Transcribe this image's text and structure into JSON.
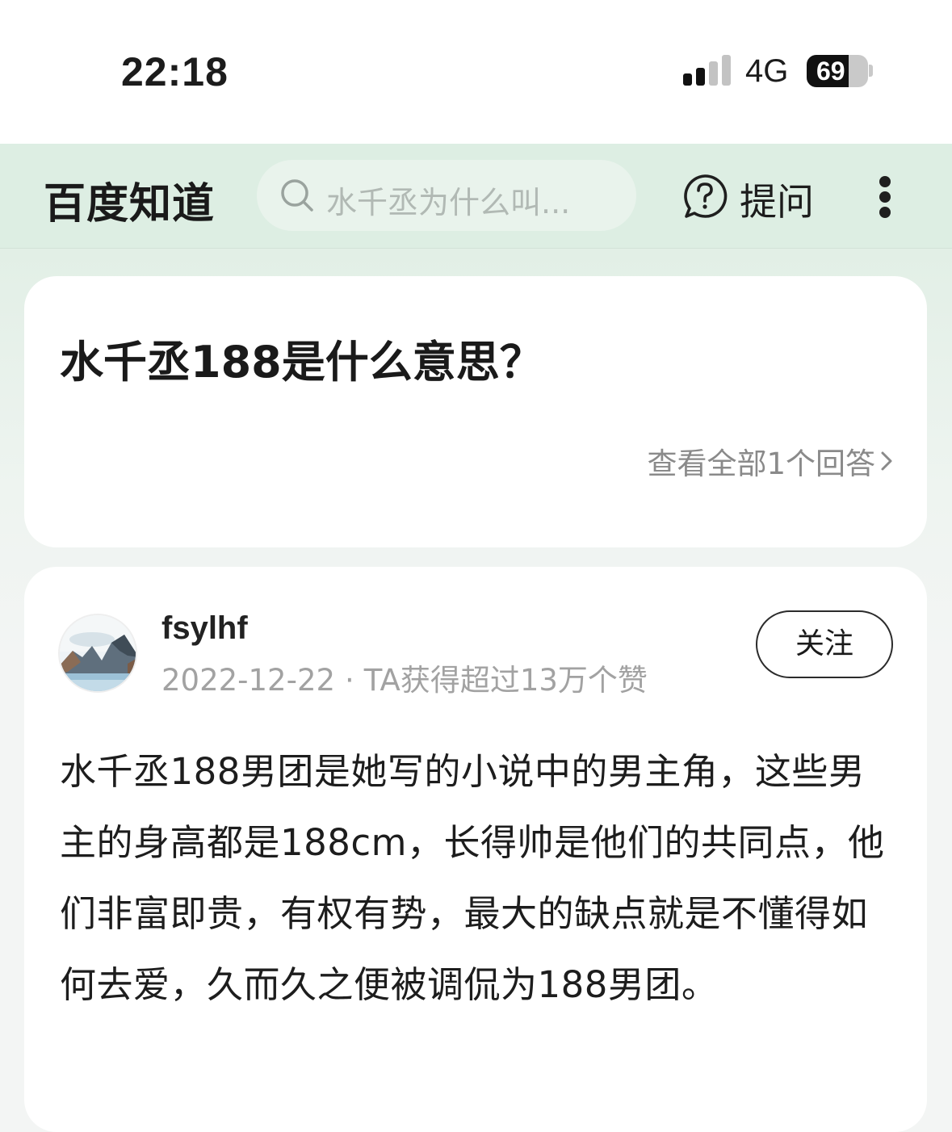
{
  "status_bar": {
    "time": "22:18",
    "network": "4G",
    "battery": "69",
    "battery_level": 0.69
  },
  "header": {
    "logo": "百度知道",
    "search_placeholder": "水千丞为什么叫...",
    "ask_label": "提问",
    "icons": [
      "search-icon",
      "question-bubble-icon",
      "more-vertical-icon"
    ]
  },
  "question": {
    "title": "水千丞188是什么意思？",
    "view_all": "查看全部1个回答"
  },
  "answer": {
    "username": "fsylhf",
    "date": "2022-12-22",
    "dot": "·",
    "likes_text": "TA获得超过13万个赞",
    "follow_label": "关注",
    "text": "水千丞188男团是她写的小说中的男主角，这些男主的身高都是188cm，长得帅是他们的共同点，他们非富即贵，有权有势，最大的缺点就是不懂得如何去爱，久而久之便被调侃为188男团。"
  },
  "colors": {
    "header_bg": "#ddeee3",
    "search_bg": "#e9f3ec",
    "muted_text": "#8a8a8a"
  }
}
